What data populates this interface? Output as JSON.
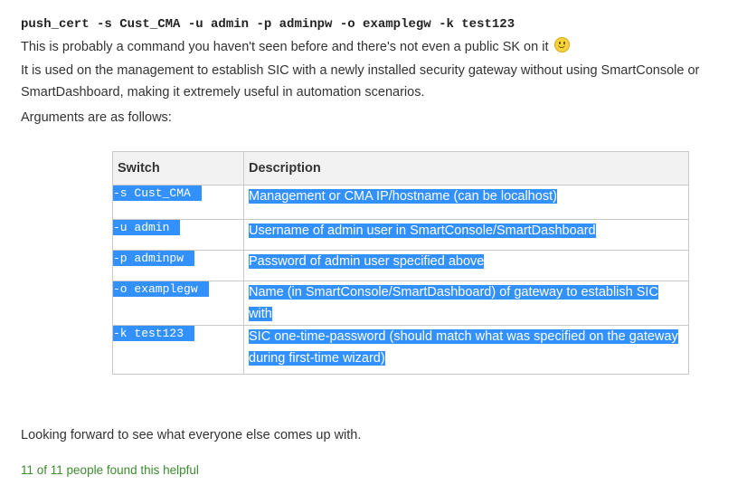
{
  "command": "push_cert -s Cust_CMA -u admin -p adminpw -o examplegw -k test123",
  "intro_line1": "This is probably a command you haven't seen before and there's not even a public SK on it",
  "intro_line2": "It is used on the management to establish SIC with a newly installed security gateway without using SmartConsole or SmartDashboard, making it extremely useful in automation scenarios.",
  "arguments_heading": "Arguments are as follows:",
  "table": {
    "headers": [
      "Switch",
      "Description"
    ],
    "rows": [
      {
        "switch": "-s Cust_CMA",
        "description": "Management or CMA IP/hostname (can be localhost)"
      },
      {
        "switch": "-u admin",
        "description": "Username of admin user in SmartConsole/SmartDashboard"
      },
      {
        "switch": "-p adminpw",
        "description": "Password of admin user specified above"
      },
      {
        "switch": "-o examplegw",
        "description": "Name (in SmartConsole/SmartDashboard) of gateway to establish SIC with"
      },
      {
        "switch": "-k test123",
        "description": "SIC one-time-password (should match what was specified on the gateway during first-time wizard)"
      }
    ]
  },
  "closing": "Looking forward to see what everyone else comes up with.",
  "helpful_text": "11 of 11 people found this helpful",
  "colors": {
    "selection": "#3390ff",
    "helpful": "#3d8b2f"
  }
}
